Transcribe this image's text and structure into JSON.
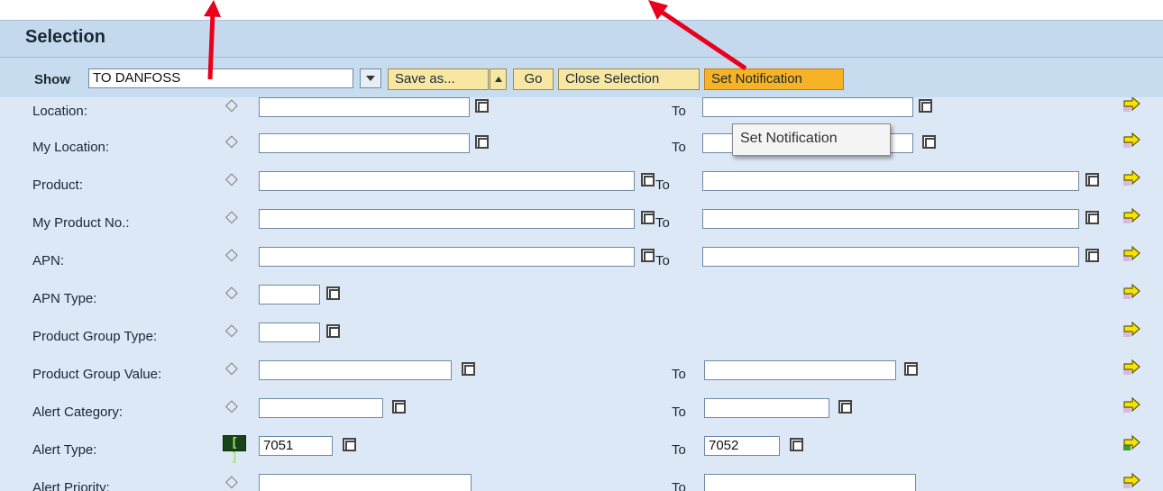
{
  "header": {
    "title": "Selection"
  },
  "toolbar": {
    "show_label": "Show",
    "variant_value": "TO DANFOSS",
    "save_label": "Save as...",
    "go_label": "Go",
    "close_label": "Close Selection",
    "notify_label": "Set Notification"
  },
  "tooltip": {
    "text": "Set Notification"
  },
  "rows": [
    {
      "label": "Location:",
      "from": "",
      "to_label": "To",
      "to": ""
    },
    {
      "label": "My Location:",
      "from": "",
      "to_label": "To",
      "to": ""
    },
    {
      "label": "Product:",
      "from": "",
      "to_label": "To",
      "to": ""
    },
    {
      "label": "My Product No.:",
      "from": "",
      "to_label": "To",
      "to": ""
    },
    {
      "label": "APN:",
      "from": "",
      "to_label": "To",
      "to": ""
    },
    {
      "label": "APN Type:",
      "from": ""
    },
    {
      "label": "Product Group Type:",
      "from": ""
    },
    {
      "label": "Product Group Value:",
      "from": "",
      "to_label": "To",
      "to": ""
    },
    {
      "label": "Alert Category:",
      "from": "",
      "to_label": "To",
      "to": ""
    },
    {
      "label": "Alert Type:",
      "from": "7051",
      "to_label": "To",
      "to": "7052",
      "operator": "[ ]"
    },
    {
      "label": "Alert Priority:",
      "from": "",
      "to_label": "To",
      "to": ""
    }
  ],
  "colors": {
    "header_bg": "#c5d9ee",
    "body_bg": "#dce8f5",
    "button_bg": "#f7e7a3",
    "highlight_button_bg": "#f5b325",
    "annotation_arrow": "#e8001c",
    "multi_select_arrow": "#f5e400",
    "multi_select_arrow_active": "#3aa02a"
  },
  "icons": {
    "operator": "diamond-icon",
    "value_help": "value-help-icon",
    "multiple_selection": "multiple-selection-arrow-icon",
    "annotation": "red-annotation-arrow"
  }
}
